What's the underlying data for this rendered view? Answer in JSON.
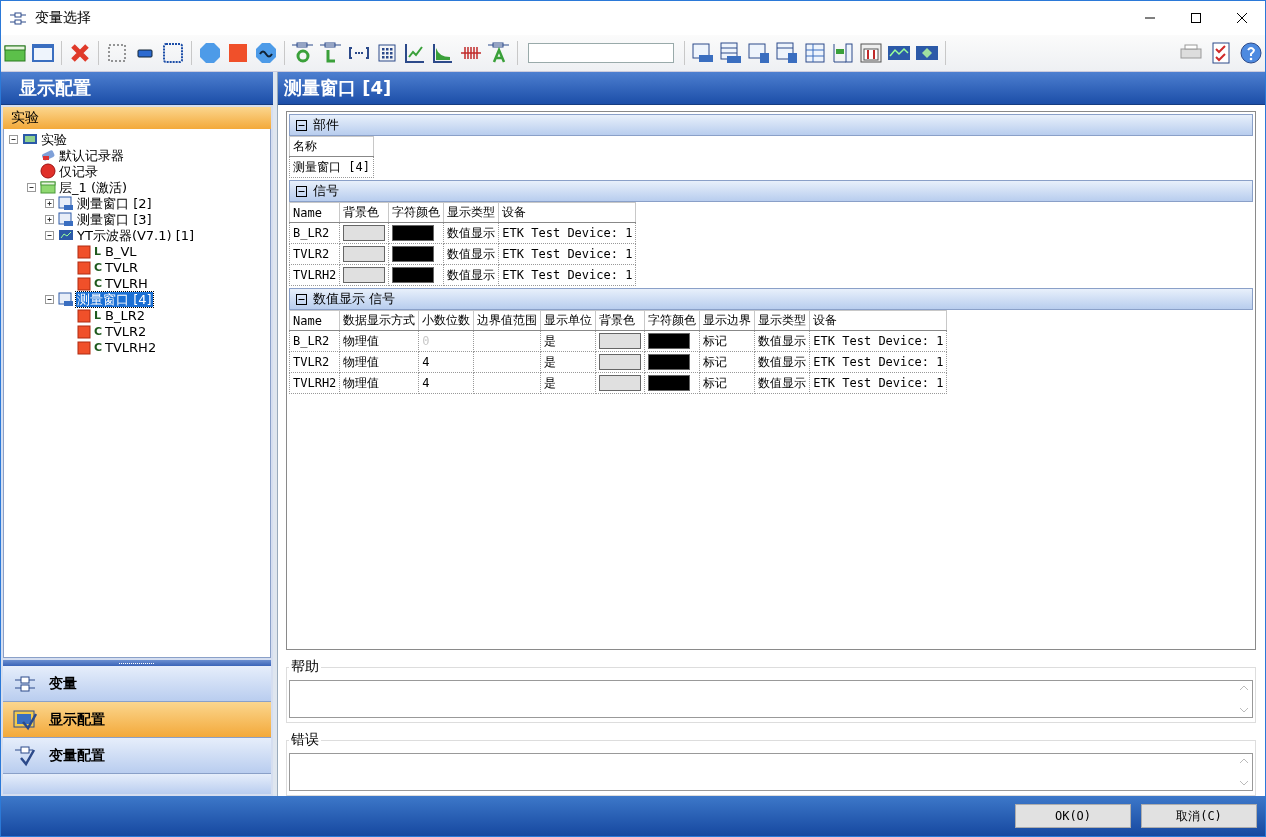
{
  "window": {
    "title": "变量选择"
  },
  "left_panel": {
    "title": "显示配置",
    "section": "实验",
    "tree": [
      {
        "label": "实验",
        "kind": "experiment",
        "expanded": true,
        "selected": false,
        "children": [
          {
            "label": "默认记录器",
            "kind": "recorder",
            "selected": false
          },
          {
            "label": "仅记录",
            "kind": "record",
            "selected": false
          },
          {
            "label": "层_1 (激活)",
            "kind": "layer",
            "expanded": true,
            "selected": false,
            "children": [
              {
                "label": "测量窗口 [2]",
                "kind": "window",
                "expanded": false,
                "selected": false
              },
              {
                "label": "测量窗口 [3]",
                "kind": "window",
                "expanded": false,
                "selected": false
              },
              {
                "label": "YT示波器(V7.1) [1]",
                "kind": "scope",
                "expanded": true,
                "selected": false,
                "children": [
                  {
                    "label": "B_VL",
                    "kind": "signal",
                    "type": "L",
                    "selected": false
                  },
                  {
                    "label": "TVLR",
                    "kind": "signal",
                    "type": "C",
                    "selected": false
                  },
                  {
                    "label": "TVLRH",
                    "kind": "signal",
                    "type": "C",
                    "selected": false
                  }
                ]
              },
              {
                "label": "测量窗口 [4]",
                "kind": "window",
                "expanded": true,
                "selected": true,
                "children": [
                  {
                    "label": "B_LR2",
                    "kind": "signal",
                    "type": "L",
                    "selected": false
                  },
                  {
                    "label": "TVLR2",
                    "kind": "signal",
                    "type": "C",
                    "selected": false
                  },
                  {
                    "label": "TVLRH2",
                    "kind": "signal",
                    "type": "C",
                    "selected": false
                  }
                ]
              }
            ]
          }
        ]
      }
    ],
    "nav": [
      {
        "label": "变量",
        "kind": "variables",
        "selected": false
      },
      {
        "label": "显示配置",
        "kind": "display",
        "selected": true
      },
      {
        "label": "变量配置",
        "kind": "varconfig",
        "selected": false
      }
    ]
  },
  "main": {
    "title": "测量窗口 [4]",
    "sections": [
      {
        "title": "部件",
        "expanded": true,
        "columns": [
          "名称"
        ],
        "rows": [
          [
            {
              "kind": "text",
              "text": "测量窗口 [4]"
            }
          ]
        ]
      },
      {
        "title": "信号",
        "expanded": true,
        "columns": [
          "Name",
          "背景色",
          "字符颜色",
          "显示类型",
          "设备"
        ],
        "rows": [
          [
            {
              "kind": "text",
              "text": "B_LR2"
            },
            {
              "kind": "swatch",
              "color": "#e0e0e0"
            },
            {
              "kind": "swatch",
              "color": "#000000"
            },
            {
              "kind": "text",
              "text": "数值显示"
            },
            {
              "kind": "text",
              "text": "ETK Test Device: 1"
            }
          ],
          [
            {
              "kind": "text",
              "text": "TVLR2"
            },
            {
              "kind": "swatch",
              "color": "#e0e0e0"
            },
            {
              "kind": "swatch",
              "color": "#000000"
            },
            {
              "kind": "text",
              "text": "数值显示"
            },
            {
              "kind": "text",
              "text": "ETK Test Device: 1"
            }
          ],
          [
            {
              "kind": "text",
              "text": "TVLRH2"
            },
            {
              "kind": "swatch",
              "color": "#e0e0e0"
            },
            {
              "kind": "swatch",
              "color": "#000000"
            },
            {
              "kind": "text",
              "text": "数值显示"
            },
            {
              "kind": "text",
              "text": "ETK Test Device: 1"
            }
          ]
        ]
      },
      {
        "title": "数值显示 信号",
        "expanded": true,
        "columns": [
          "Name",
          "数据显示方式",
          "小数位数",
          "边界值范围",
          "显示单位",
          "背景色",
          "字符颜色",
          "显示边界",
          "显示类型",
          "设备"
        ],
        "rows": [
          [
            {
              "kind": "text",
              "text": "B_LR2"
            },
            {
              "kind": "text",
              "text": "物理值"
            },
            {
              "kind": "muted",
              "text": "0"
            },
            {
              "kind": "empty"
            },
            {
              "kind": "text",
              "text": "是"
            },
            {
              "kind": "swatch",
              "color": "#e0e0e0"
            },
            {
              "kind": "swatch",
              "color": "#000000"
            },
            {
              "kind": "text",
              "text": "标记"
            },
            {
              "kind": "text",
              "text": "数值显示"
            },
            {
              "kind": "text",
              "text": "ETK Test Device: 1"
            }
          ],
          [
            {
              "kind": "text",
              "text": "TVLR2"
            },
            {
              "kind": "text",
              "text": "物理值"
            },
            {
              "kind": "text",
              "text": "4"
            },
            {
              "kind": "empty"
            },
            {
              "kind": "text",
              "text": "是"
            },
            {
              "kind": "swatch",
              "color": "#e0e0e0"
            },
            {
              "kind": "swatch",
              "color": "#000000"
            },
            {
              "kind": "text",
              "text": "标记"
            },
            {
              "kind": "text",
              "text": "数值显示"
            },
            {
              "kind": "text",
              "text": "ETK Test Device: 1"
            }
          ],
          [
            {
              "kind": "text",
              "text": "TVLRH2"
            },
            {
              "kind": "text",
              "text": "物理值"
            },
            {
              "kind": "text",
              "text": "4"
            },
            {
              "kind": "empty"
            },
            {
              "kind": "text",
              "text": "是"
            },
            {
              "kind": "swatch",
              "color": "#e0e0e0"
            },
            {
              "kind": "swatch",
              "color": "#000000"
            },
            {
              "kind": "text",
              "text": "标记"
            },
            {
              "kind": "text",
              "text": "数值显示"
            },
            {
              "kind": "text",
              "text": "ETK Test Device: 1"
            }
          ]
        ]
      }
    ]
  },
  "help": {
    "label": "帮助"
  },
  "error": {
    "label": "错误"
  },
  "buttons": [
    "OK(O)",
    "取消(C)"
  ]
}
